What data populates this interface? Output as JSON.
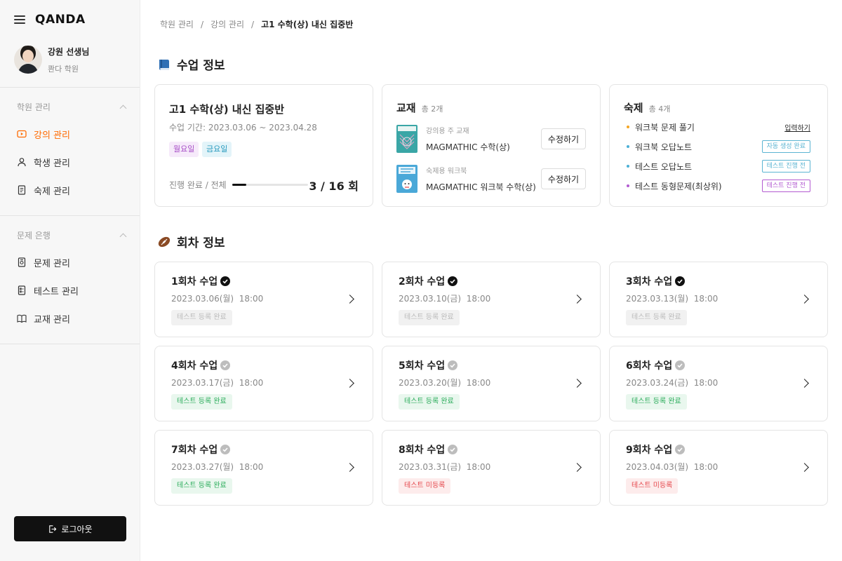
{
  "app": {
    "logo": "QANDA"
  },
  "profile": {
    "name": "강원 선생님",
    "org": "콴다 학원"
  },
  "sidebar": {
    "sections": [
      {
        "label": "학원 관리",
        "items": [
          {
            "label": "강의 관리",
            "icon": "play-icon",
            "active": true
          },
          {
            "label": "학생 관리",
            "icon": "person-icon",
            "active": false
          },
          {
            "label": "숙제 관리",
            "icon": "document-icon",
            "active": false
          }
        ]
      },
      {
        "label": "문제 은행",
        "items": [
          {
            "label": "문제 관리",
            "icon": "question-doc-icon",
            "active": false
          },
          {
            "label": "테스트 관리",
            "icon": "test-doc-icon",
            "active": false
          },
          {
            "label": "교재 관리",
            "icon": "book-icon",
            "active": false
          }
        ]
      }
    ],
    "logout_label": "로그아웃"
  },
  "breadcrumb": [
    "학원 관리",
    "강의 관리",
    "고1 수학(상) 내신 집중반"
  ],
  "class_section": {
    "title": "수업 정보",
    "course": {
      "title": "고1 수학(상) 내신 집중반",
      "period": "수업 기간: 2023.03.06 ~ 2023.04.28",
      "days": [
        "월요일",
        "금요일"
      ],
      "progress_label": "진행 완료 / 전체",
      "progress_count": "3 / 16 회",
      "progress_fraction": 0.1875
    },
    "textbooks": {
      "title": "교재",
      "count": "총 2개",
      "items": [
        {
          "sub": "강의용 주 교재",
          "name": "MAGMATHIC 수학(상)",
          "button": "수정하기"
        },
        {
          "sub": "숙제용 워크북",
          "name": "MAGMATHIC 워크북 수학(상)",
          "button": "수정하기"
        }
      ]
    },
    "homework": {
      "title": "숙제",
      "count": "총 4개",
      "items": [
        {
          "label": "워크북 문제 풀기",
          "action": "입력하기",
          "type": "link",
          "dot": "#f5a623"
        },
        {
          "label": "워크북 오답노트",
          "action": "자동 생성 완료",
          "type": "tag",
          "dot": "#4bb0d6",
          "color": "#5bb4d2"
        },
        {
          "label": "테스트 오답노트",
          "action": "테스트 진행 전",
          "type": "tag",
          "dot": "#4bb0d6",
          "color": "#5bb4d2"
        },
        {
          "label": "테스트 동형문제(최상위)",
          "action": "테스트 진행 전",
          "type": "tag",
          "dot": "#b35bd1",
          "color": "#b35bd1"
        }
      ]
    }
  },
  "session_section": {
    "title": "회차 정보",
    "sessions": [
      {
        "title": "1회차 수업",
        "date": "2023.03.06(월)  18:00",
        "tag": "테스트 등록 완료",
        "status": "gray",
        "done": true
      },
      {
        "title": "2회차 수업",
        "date": "2023.03.10(금)  18:00",
        "tag": "테스트 등록 완료",
        "status": "gray",
        "done": true
      },
      {
        "title": "3회차 수업",
        "date": "2023.03.13(월)  18:00",
        "tag": "테스트 등록 완료",
        "status": "gray",
        "done": true
      },
      {
        "title": "4회차 수업",
        "date": "2023.03.17(금)  18:00",
        "tag": "테스트 등록 완료",
        "status": "green",
        "done": false
      },
      {
        "title": "5회차 수업",
        "date": "2023.03.20(월)  18:00",
        "tag": "테스트 등록 완료",
        "status": "green",
        "done": false
      },
      {
        "title": "6회차 수업",
        "date": "2023.03.24(금)  18:00",
        "tag": "테스트 등록 완료",
        "status": "green",
        "done": false
      },
      {
        "title": "7회차 수업",
        "date": "2023.03.27(월)  18:00",
        "tag": "테스트 등록 완료",
        "status": "green",
        "done": false
      },
      {
        "title": "8회차 수업",
        "date": "2023.03.31(금)  18:00",
        "tag": "테스트 미등록",
        "status": "red",
        "done": false
      },
      {
        "title": "9회차 수업",
        "date": "2023.04.03(월)  18:00",
        "tag": "테스트 미등록",
        "status": "red",
        "done": false
      }
    ]
  },
  "colors": {
    "accent": "#ff6a00",
    "green": "#2fae5e",
    "red": "#e5484d"
  }
}
